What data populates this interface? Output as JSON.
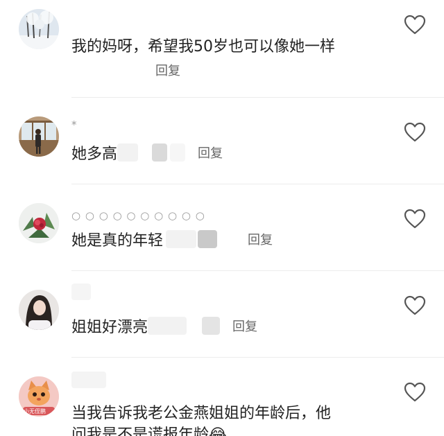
{
  "colors": {
    "text": "#222222",
    "muted": "#9a9a9a",
    "reply": "#666666",
    "divider": "#ececec",
    "heart_stroke": "#555555"
  },
  "comments": [
    {
      "username": "",
      "text": "我的妈呀，希望我50岁也可以像她一样",
      "reply_label": "回复",
      "avatar": "snowy-tree-avatar"
    },
    {
      "username": "*",
      "text": "她多高",
      "reply_label": "回复",
      "avatar": "person-window-avatar"
    },
    {
      "username": "○ ○ ○ ○ ○ ○ ○ ○ ○ ○",
      "text": "她是真的年轻",
      "reply_label": "回复",
      "avatar": "red-flower-avatar"
    },
    {
      "username": "",
      "text": "姐姐好漂亮",
      "reply_label": "回复",
      "avatar": "girl-portrait-avatar"
    },
    {
      "username": "",
      "text": "当我告诉我老公金燕姐姐的年龄后，他",
      "text_line2": "问我是不是谎报年龄😂",
      "avatar": "cat-cartoon-avatar",
      "avatar_caption": "小无侄鹏"
    }
  ],
  "icons": {
    "like": "heart-outline-icon"
  }
}
